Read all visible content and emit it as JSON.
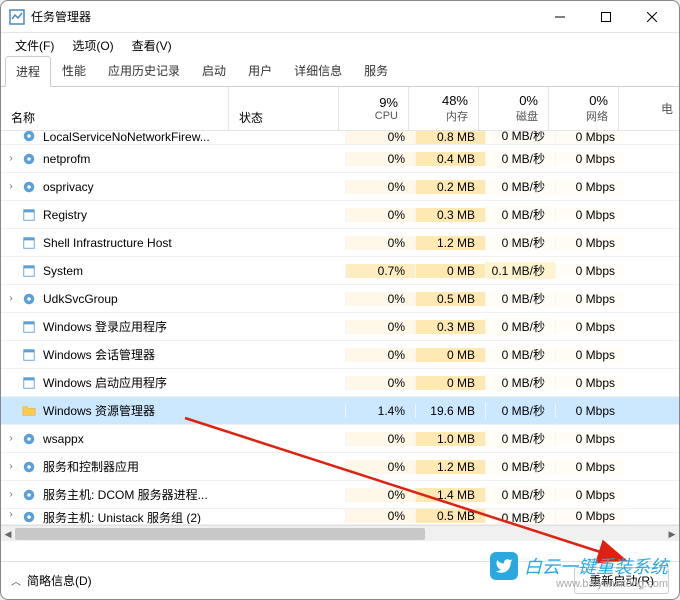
{
  "window": {
    "title": "任务管理器"
  },
  "menu": {
    "file": "文件(F)",
    "options": "选项(O)",
    "view": "查看(V)"
  },
  "tabs": {
    "processes": "进程",
    "performance": "性能",
    "app_history": "应用历史记录",
    "startup": "启动",
    "users": "用户",
    "details": "详细信息",
    "services": "服务"
  },
  "columns": {
    "name": "名称",
    "status": "状态",
    "cpu_pct": "9%",
    "cpu_label": "CPU",
    "mem_pct": "48%",
    "mem_label": "内存",
    "disk_pct": "0%",
    "disk_label": "磁盘",
    "net_pct": "0%",
    "net_label": "网络",
    "tail": "电"
  },
  "rows": [
    {
      "exp": "",
      "icon": "gear",
      "name": "LocalServiceNoNetworkFirew...",
      "cpu": "0%",
      "mem": "0.8 MB",
      "disk": "0 MB/秒",
      "net": "0 Mbps",
      "cut": "top"
    },
    {
      "exp": "›",
      "icon": "gear",
      "name": "netprofm",
      "cpu": "0%",
      "mem": "0.4 MB",
      "disk": "0 MB/秒",
      "net": "0 Mbps"
    },
    {
      "exp": "›",
      "icon": "gear",
      "name": "osprivacy",
      "cpu": "0%",
      "mem": "0.2 MB",
      "disk": "0 MB/秒",
      "net": "0 Mbps"
    },
    {
      "exp": "",
      "icon": "app",
      "name": "Registry",
      "cpu": "0%",
      "mem": "0.3 MB",
      "disk": "0 MB/秒",
      "net": "0 Mbps"
    },
    {
      "exp": "",
      "icon": "app",
      "name": "Shell Infrastructure Host",
      "cpu": "0%",
      "mem": "1.2 MB",
      "disk": "0 MB/秒",
      "net": "0 Mbps"
    },
    {
      "exp": "",
      "icon": "app",
      "name": "System",
      "cpu": "0.7%",
      "mem": "0 MB",
      "disk": "0.1 MB/秒",
      "net": "0 Mbps",
      "cpu_mid": true,
      "disk_mid": true
    },
    {
      "exp": "›",
      "icon": "gear",
      "name": "UdkSvcGroup",
      "cpu": "0%",
      "mem": "0.5 MB",
      "disk": "0 MB/秒",
      "net": "0 Mbps"
    },
    {
      "exp": "",
      "icon": "app",
      "name": "Windows 登录应用程序",
      "cpu": "0%",
      "mem": "0.3 MB",
      "disk": "0 MB/秒",
      "net": "0 Mbps"
    },
    {
      "exp": "",
      "icon": "app",
      "name": "Windows 会话管理器",
      "cpu": "0%",
      "mem": "0 MB",
      "disk": "0 MB/秒",
      "net": "0 Mbps"
    },
    {
      "exp": "",
      "icon": "app",
      "name": "Windows 启动应用程序",
      "cpu": "0%",
      "mem": "0 MB",
      "disk": "0 MB/秒",
      "net": "0 Mbps"
    },
    {
      "exp": "",
      "icon": "folder",
      "name": "Windows 资源管理器",
      "cpu": "1.4%",
      "mem": "19.6 MB",
      "disk": "0 MB/秒",
      "net": "0 Mbps",
      "selected": true
    },
    {
      "exp": "›",
      "icon": "gear",
      "name": "wsappx",
      "cpu": "0%",
      "mem": "1.0 MB",
      "disk": "0 MB/秒",
      "net": "0 Mbps"
    },
    {
      "exp": "›",
      "icon": "gear",
      "name": "服务和控制器应用",
      "cpu": "0%",
      "mem": "1.2 MB",
      "disk": "0 MB/秒",
      "net": "0 Mbps"
    },
    {
      "exp": "›",
      "icon": "gear",
      "name": "服务主机: DCOM 服务器进程...",
      "cpu": "0%",
      "mem": "1.4 MB",
      "disk": "0 MB/秒",
      "net": "0 Mbps"
    },
    {
      "exp": "›",
      "icon": "gear",
      "name": "服务主机: Unistack 服务组 (2)",
      "cpu": "0%",
      "mem": "0.5 MB",
      "disk": "0 MB/秒",
      "net": "0 Mbps",
      "cut": "bot"
    }
  ],
  "footer": {
    "less": "简略信息(D)",
    "restart": "重新启动(R)"
  },
  "watermark": {
    "text1": "白云一键重装系统",
    "text2": "www.baiyunxitong.com"
  }
}
